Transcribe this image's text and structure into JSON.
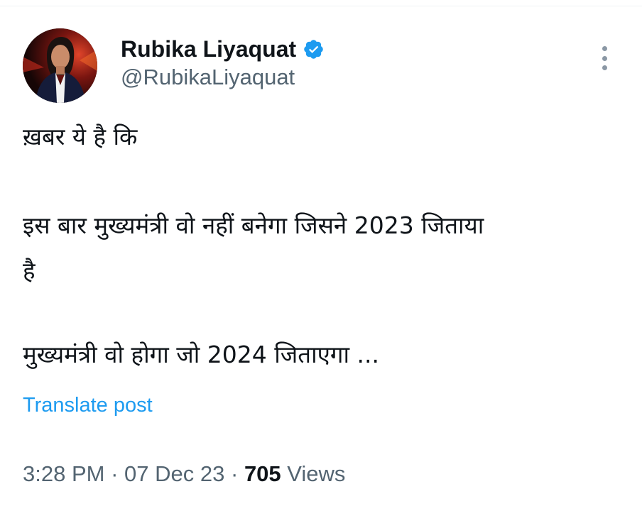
{
  "author": {
    "display_name": "Rubika Liyaquat",
    "handle": "@RubikaLiyaquat",
    "verified": true
  },
  "tweet": {
    "lines": [
      "ख़बर ये है कि",
      "इस बार मुख्यमंत्री वो नहीं बनेगा जिसने 2023 जिताया",
      "है",
      "मुख्यमंत्री वो होगा जो 2024 जिताएगा ..."
    ],
    "translate_label": "Translate post"
  },
  "meta": {
    "time": "3:28 PM",
    "separator": "·",
    "date": "07 Dec 23",
    "views_count": "705",
    "views_label": "Views"
  },
  "colors": {
    "accent": "#1d9bf0",
    "secondary_text": "#536471",
    "primary_text": "#0f1419"
  },
  "icons": {
    "verified": "verified-badge-icon",
    "more": "more-options-icon"
  }
}
